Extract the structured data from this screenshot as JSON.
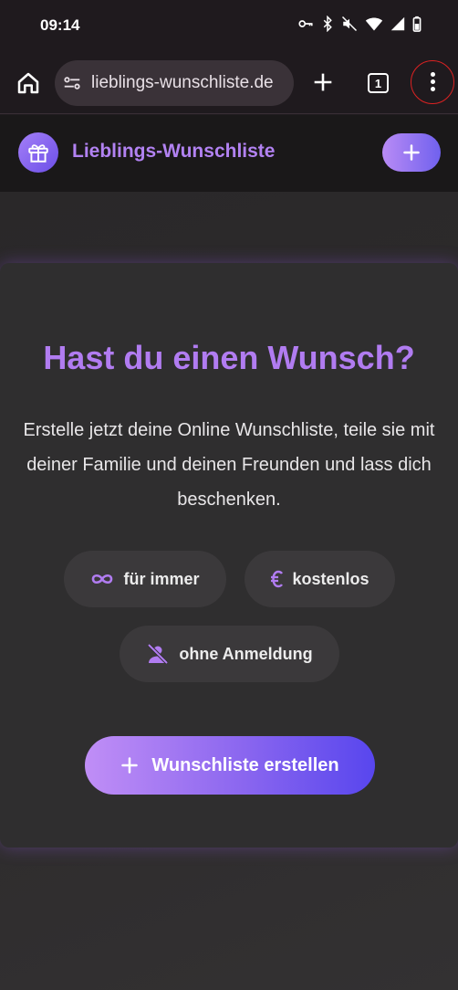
{
  "status_bar": {
    "time": "09:14",
    "icons": [
      "key-icon",
      "bluetooth-icon",
      "mute-icon",
      "wifi-icon",
      "signal-icon",
      "battery-icon"
    ]
  },
  "browser": {
    "url": "lieblings-wunschliste.de",
    "tab_count": "1"
  },
  "site": {
    "title": "Lieblings-Wunschliste"
  },
  "hero": {
    "title": "Hast du einen Wunsch?",
    "text": "Erstelle jetzt deine Online Wunschliste, teile sie mit deiner Familie und deinen Freunden und lass dich beschenken.",
    "features": [
      {
        "label": "für immer",
        "icon": "infinity-icon"
      },
      {
        "label": "kostenlos",
        "icon": "euro-icon"
      },
      {
        "label": "ohne Anmeldung",
        "icon": "person-off-icon"
      }
    ],
    "cta_label": "Wunschliste erstellen"
  },
  "colors": {
    "accent": "#b17cf1",
    "gradient_start": "#c08ef6",
    "gradient_end": "#5846ee",
    "card_bg": "#2f2e2f"
  }
}
